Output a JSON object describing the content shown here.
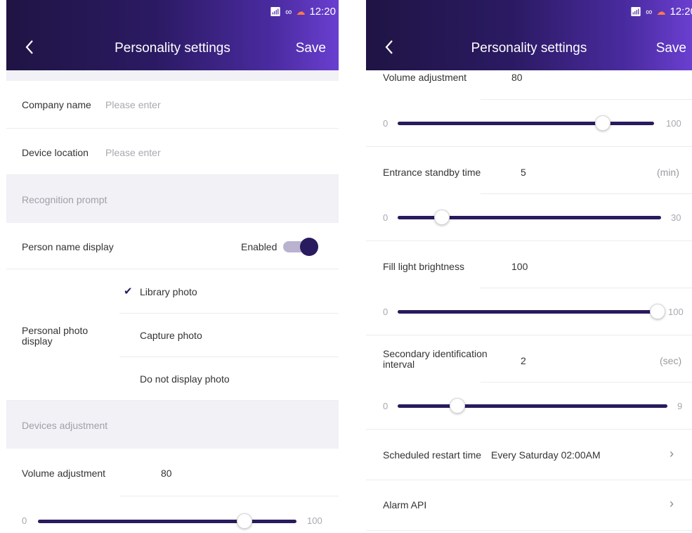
{
  "status": {
    "time": "12:20"
  },
  "header": {
    "back_label": "",
    "title": "Personality settings",
    "save_label": "Save"
  },
  "left": {
    "company": {
      "label": "Company name",
      "placeholder": "Please enter"
    },
    "location": {
      "label": "Device location",
      "placeholder": "Please enter"
    },
    "recognition_section": "Recognition prompt",
    "person_name": {
      "label": "Person name display",
      "state": "Enabled"
    },
    "photo_display": {
      "label": "Personal photo display",
      "options": [
        "Library photo",
        "Capture photo",
        "Do not display photo"
      ],
      "selected": 0
    },
    "devices_section": "Devices adjustment",
    "volume": {
      "label": "Volume adjustment",
      "value": "80",
      "min": "0",
      "max": "100",
      "level": 80
    }
  },
  "right": {
    "volume": {
      "label": "Volume adjustment",
      "value": "80",
      "min": "0",
      "max": "100",
      "level": 80
    },
    "standby": {
      "label": "Entrance standby time",
      "value": "5",
      "unit": "(min)",
      "min": "0",
      "max": "30",
      "level": 5
    },
    "fill_light": {
      "label": "Fill light brightness",
      "value": "100",
      "min": "0",
      "max": "100",
      "level": 100
    },
    "secondary": {
      "label": "Secondary identification interval",
      "value": "2",
      "unit": "(sec)",
      "min": "0",
      "max": "9",
      "level": 2
    },
    "restart": {
      "label": "Scheduled restart time",
      "value": "Every Saturday 02:00AM"
    },
    "alarm": {
      "label": "Alarm API"
    }
  },
  "colors": {
    "accent": "#2a1a5e",
    "header_start": "#1f1444",
    "header_end": "#6a3fd0"
  }
}
